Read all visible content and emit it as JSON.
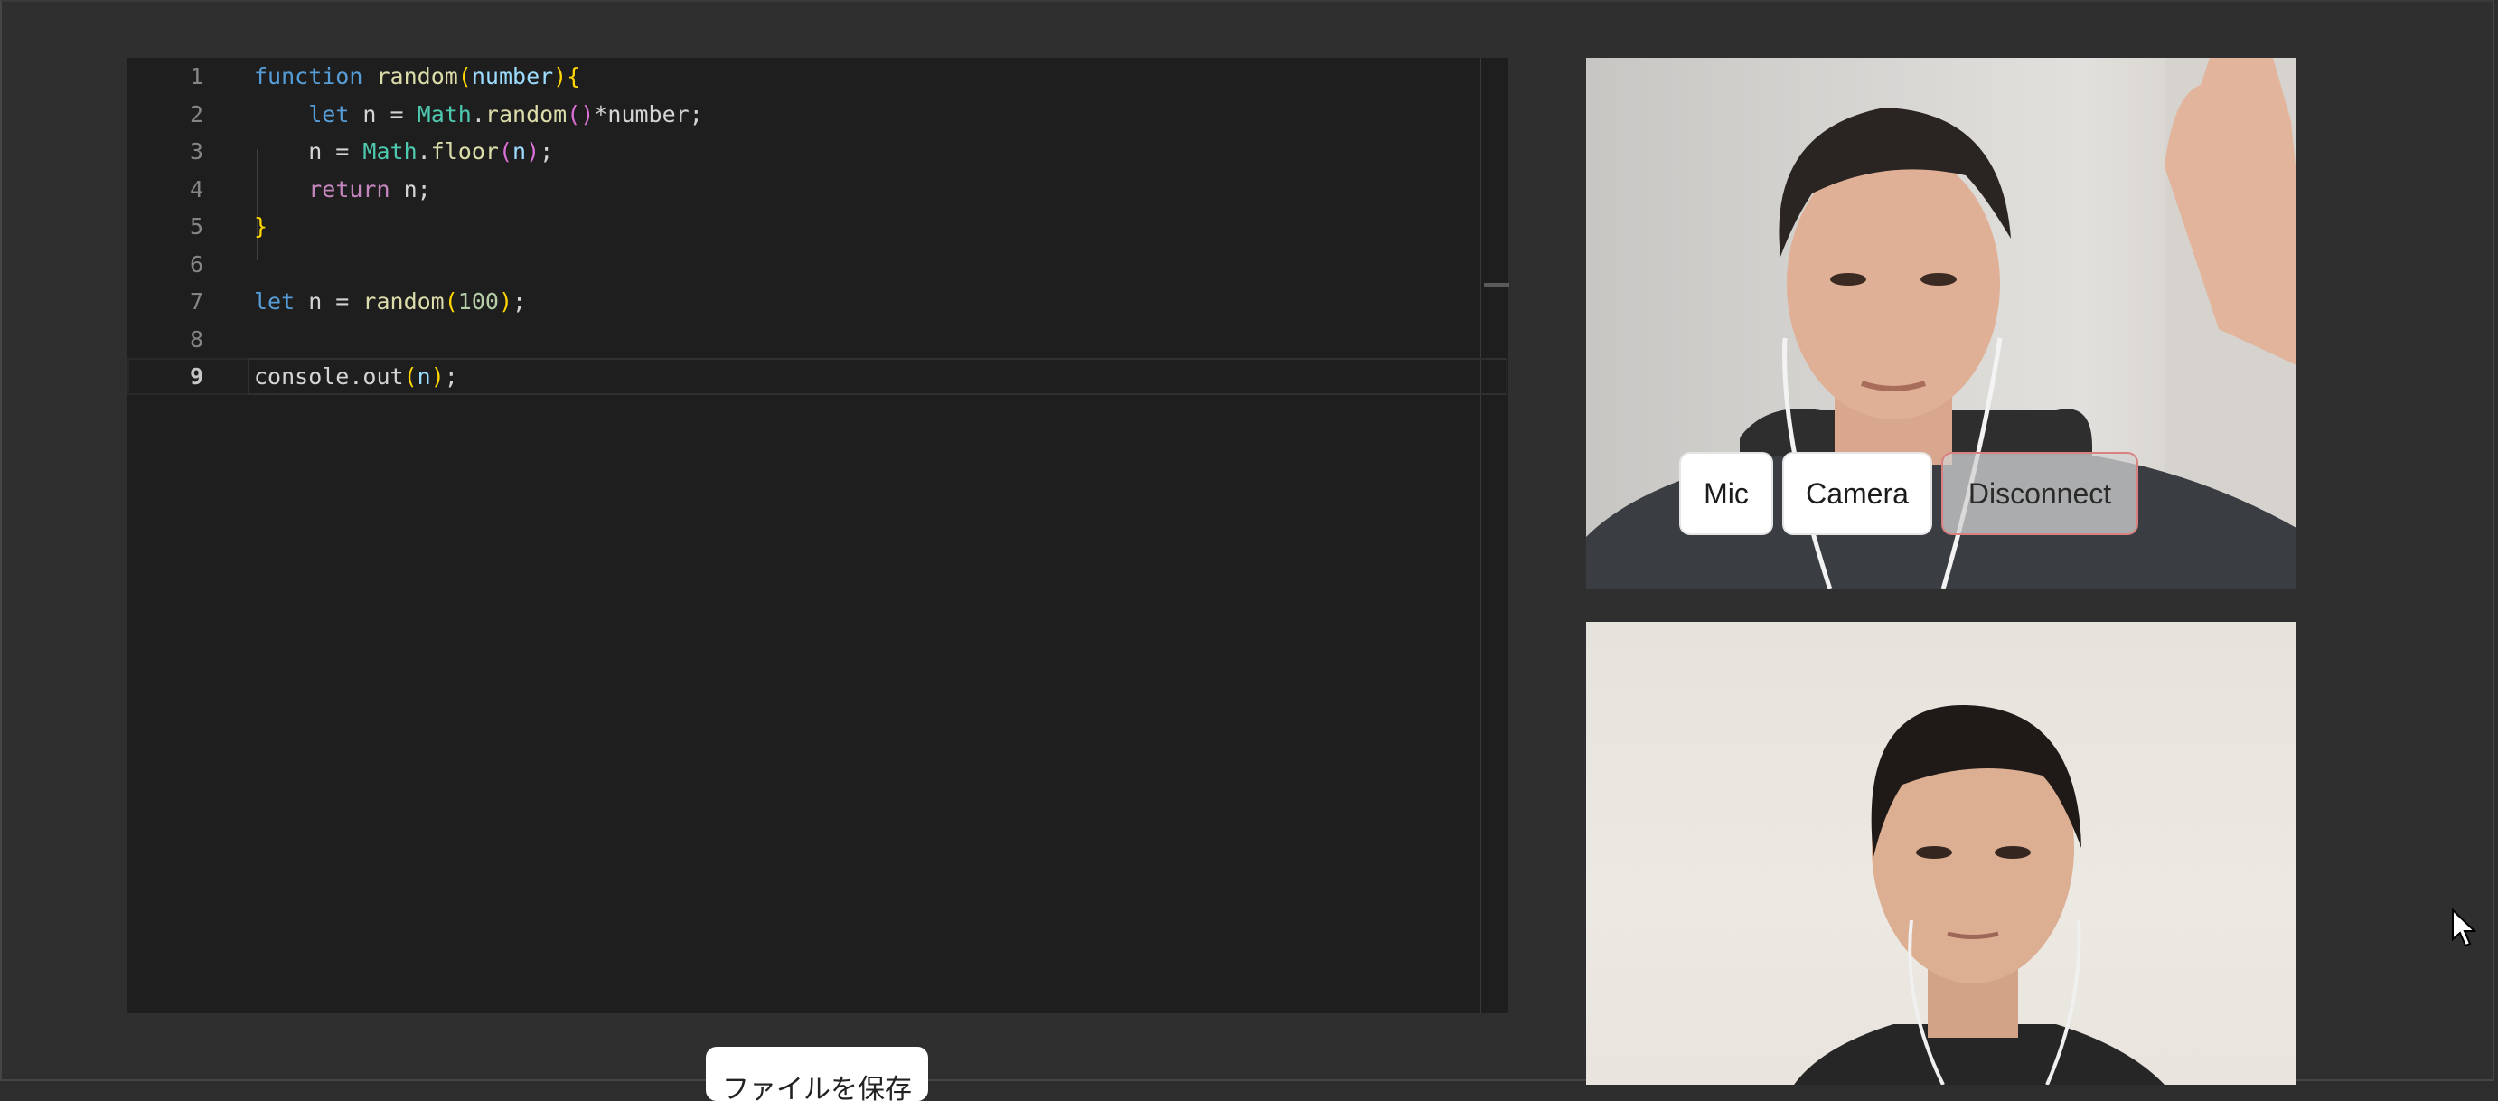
{
  "editor": {
    "lines": [
      {
        "num": "1",
        "tokens": [
          [
            "kw",
            "function"
          ],
          [
            "txt",
            " "
          ],
          [
            "fn",
            "random"
          ],
          [
            "br1",
            "("
          ],
          [
            "var",
            "number"
          ],
          [
            "br1",
            ")"
          ],
          [
            "br1",
            "{"
          ]
        ]
      },
      {
        "num": "2",
        "tokens": [
          [
            "txt",
            "    "
          ],
          [
            "kw",
            "let"
          ],
          [
            "txt",
            " n = "
          ],
          [
            "type",
            "Math"
          ],
          [
            "txt",
            "."
          ],
          [
            "fn",
            "random"
          ],
          [
            "br2",
            "()"
          ],
          [
            "txt",
            "*number;"
          ]
        ]
      },
      {
        "num": "3",
        "tokens": [
          [
            "txt",
            "    n = "
          ],
          [
            "type",
            "Math"
          ],
          [
            "txt",
            "."
          ],
          [
            "fn",
            "floor"
          ],
          [
            "br2",
            "("
          ],
          [
            "var",
            "n"
          ],
          [
            "br2",
            ")"
          ],
          [
            "txt",
            ";"
          ]
        ]
      },
      {
        "num": "4",
        "tokens": [
          [
            "txt",
            "    "
          ],
          [
            "ctl",
            "return"
          ],
          [
            "txt",
            " n;"
          ]
        ]
      },
      {
        "num": "5",
        "tokens": [
          [
            "br1",
            "}"
          ]
        ]
      },
      {
        "num": "6",
        "tokens": []
      },
      {
        "num": "7",
        "tokens": [
          [
            "kw",
            "let"
          ],
          [
            "txt",
            " n = "
          ],
          [
            "fn",
            "random"
          ],
          [
            "br1",
            "("
          ],
          [
            "num",
            "100"
          ],
          [
            "br1",
            ")"
          ],
          [
            "txt",
            ";"
          ]
        ]
      },
      {
        "num": "8",
        "tokens": []
      },
      {
        "num": "9",
        "tokens": [
          [
            "txt",
            "console.out"
          ],
          [
            "br1",
            "("
          ],
          [
            "var",
            "n"
          ],
          [
            "br1",
            ")"
          ],
          [
            "txt",
            ";"
          ]
        ]
      }
    ],
    "active_line": "9"
  },
  "video_controls": {
    "mic": "Mic",
    "camera": "Camera",
    "disconnect": "Disconnect"
  },
  "save_button": {
    "label": "ファイルを保存"
  },
  "colors": {
    "background": "#2f2f2f",
    "editor_bg": "#1e1e1e",
    "disconnect_border": "#d98080"
  }
}
